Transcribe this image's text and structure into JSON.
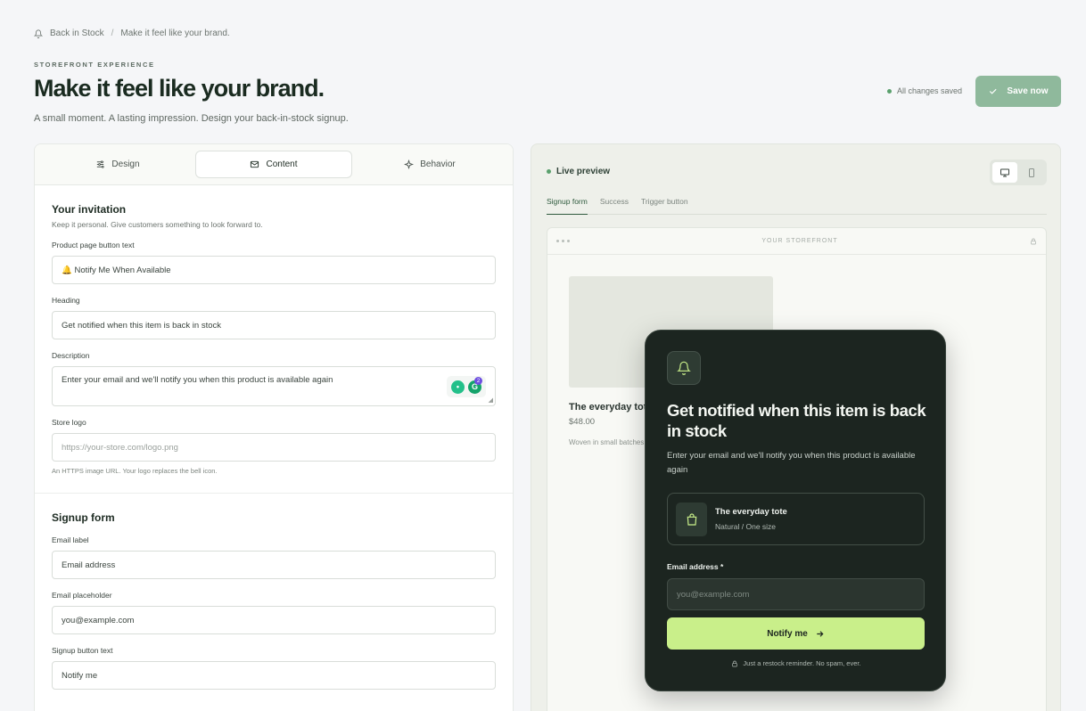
{
  "breadcrumb": {
    "root": "Back in Stock",
    "separator": "/",
    "current": "Make it feel like your brand."
  },
  "header": {
    "eyebrow": "STOREFRONT EXPERIENCE",
    "title": "Make it feel like your brand.",
    "subtitle": "A small moment. A lasting impression. Design your back-in-stock signup.",
    "status": "All changes saved",
    "save_label": "Save now"
  },
  "tabs": [
    {
      "label": "Design",
      "icon": "sliders-icon"
    },
    {
      "label": "Content",
      "icon": "mail-icon",
      "active": true
    },
    {
      "label": "Behavior",
      "icon": "sparkle-icon"
    }
  ],
  "invitation": {
    "title": "Your invitation",
    "subtitle": "Keep it personal. Give customers something to look forward to.",
    "button_text_label": "Product page button text",
    "button_text_value": "🔔 Notify Me When Available",
    "heading_label": "Heading",
    "heading_value": "Get notified when this item is back in stock",
    "description_label": "Description",
    "description_value": "Enter your email and we'll notify you when this product is available again",
    "logo_label": "Store logo",
    "logo_placeholder": "https://your-store.com/logo.png",
    "logo_hint": "An HTTPS image URL. Your logo replaces the bell icon.",
    "grammar_badge": "2"
  },
  "signup": {
    "title": "Signup form",
    "email_label_label": "Email label",
    "email_label_value": "Email address",
    "email_placeholder_label": "Email placeholder",
    "email_placeholder_value": "you@example.com",
    "button_label": "Signup button text",
    "button_value": "Notify me"
  },
  "preview": {
    "live_label": "Live preview",
    "tabs": [
      "Signup form",
      "Success",
      "Trigger button"
    ],
    "storefront_label": "YOUR STOREFRONT",
    "product_name": "The everyday tote",
    "product_price": "$48.00",
    "product_desc": "Woven in small batches"
  },
  "modal": {
    "heading": "Get notified when this item is back in stock",
    "description": "Enter your email and we'll notify you when this product is available again",
    "product_name": "The everyday tote",
    "product_variant": "Natural / One size",
    "email_label": "Email address *",
    "email_placeholder": "you@example.com",
    "button": "Notify me",
    "fine_print": "Just a restock reminder. No spam, ever."
  },
  "colors": {
    "accent": "#c9ef8a",
    "save": "#8fb99c",
    "modal_bg": "#1c2520",
    "status_dot": "#5aa06d"
  }
}
